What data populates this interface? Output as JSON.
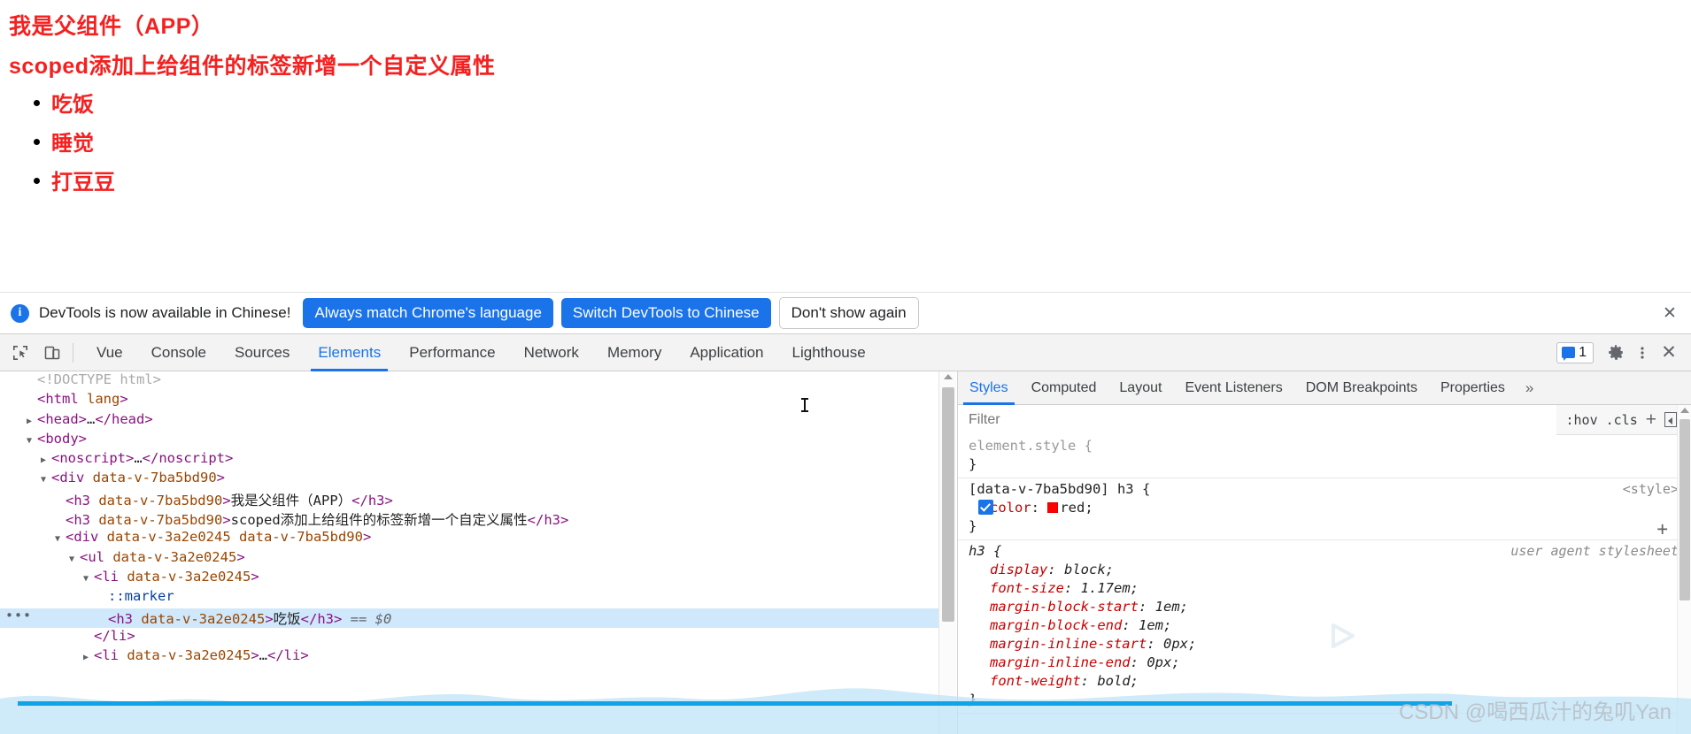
{
  "page": {
    "title1": "我是父组件（APP）",
    "title2": "scoped添加上给组件的标签新增一个自定义属性",
    "list": [
      {
        "text": "吃饭"
      },
      {
        "text": "睡觉"
      },
      {
        "text": "打豆豆"
      }
    ],
    "text_color": "#f52020"
  },
  "notification": {
    "icon": "info-icon",
    "message": "DevTools is now available in Chinese!",
    "primary_button_1": "Always match Chrome's language",
    "primary_button_2": "Switch DevTools to Chinese",
    "secondary_button": "Don't show again",
    "close_icon": "✕",
    "accent": "#1a73e8"
  },
  "devtools": {
    "tools": [
      {
        "name": "inspect-element-icon"
      },
      {
        "name": "device-toolbar-icon"
      }
    ],
    "tabs": [
      {
        "label": "Vue",
        "active": false
      },
      {
        "label": "Console",
        "active": false
      },
      {
        "label": "Sources",
        "active": false
      },
      {
        "label": "Elements",
        "active": true
      },
      {
        "label": "Performance",
        "active": false
      },
      {
        "label": "Network",
        "active": false
      },
      {
        "label": "Memory",
        "active": false
      },
      {
        "label": "Application",
        "active": false
      },
      {
        "label": "Lighthouse",
        "active": false
      }
    ],
    "issues_count": "1",
    "settings_icon": "gear-icon",
    "more_icon": "kebab-menu-icon",
    "close_icon": "✕"
  },
  "dom_tree": [
    {
      "indent": 0,
      "twisty": "",
      "segments": [
        {
          "t": "comment",
          "v": "<!DOCTYPE html>"
        }
      ]
    },
    {
      "indent": 0,
      "twisty": "",
      "segments": [
        {
          "t": "tag",
          "v": "<html "
        },
        {
          "t": "attr",
          "v": "lang"
        },
        {
          "t": "tag",
          "v": ">"
        }
      ]
    },
    {
      "indent": 0,
      "twisty": "▶",
      "segments": [
        {
          "t": "tag",
          "v": "<head>"
        },
        {
          "t": "txt",
          "v": "…"
        },
        {
          "t": "tag",
          "v": "</head>"
        }
      ]
    },
    {
      "indent": 0,
      "twisty": "▼",
      "segments": [
        {
          "t": "tag",
          "v": "<body>"
        }
      ]
    },
    {
      "indent": 1,
      "twisty": "▶",
      "segments": [
        {
          "t": "tag",
          "v": "<noscript>"
        },
        {
          "t": "txt",
          "v": "…"
        },
        {
          "t": "tag",
          "v": "</noscript>"
        }
      ]
    },
    {
      "indent": 1,
      "twisty": "▼",
      "segments": [
        {
          "t": "tag",
          "v": "<div "
        },
        {
          "t": "attr",
          "v": "data-v-7ba5bd90"
        },
        {
          "t": "tag",
          "v": ">"
        }
      ]
    },
    {
      "indent": 2,
      "twisty": "",
      "segments": [
        {
          "t": "tag",
          "v": "<h3 "
        },
        {
          "t": "attr",
          "v": "data-v-7ba5bd90"
        },
        {
          "t": "tag",
          "v": ">"
        },
        {
          "t": "txt",
          "v": "我是父组件（APP）"
        },
        {
          "t": "tag",
          "v": "</h3>"
        }
      ]
    },
    {
      "indent": 2,
      "twisty": "",
      "segments": [
        {
          "t": "tag",
          "v": "<h3 "
        },
        {
          "t": "attr",
          "v": "data-v-7ba5bd90"
        },
        {
          "t": "tag",
          "v": ">"
        },
        {
          "t": "txt",
          "v": "scoped添加上给组件的标签新增一个自定义属性"
        },
        {
          "t": "tag",
          "v": "</h3>"
        }
      ]
    },
    {
      "indent": 2,
      "twisty": "▼",
      "segments": [
        {
          "t": "tag",
          "v": "<div "
        },
        {
          "t": "attr",
          "v": "data-v-3a2e0245 data-v-7ba5bd90"
        },
        {
          "t": "tag",
          "v": ">"
        }
      ]
    },
    {
      "indent": 3,
      "twisty": "▼",
      "segments": [
        {
          "t": "tag",
          "v": "<ul "
        },
        {
          "t": "attr",
          "v": "data-v-3a2e0245"
        },
        {
          "t": "tag",
          "v": ">"
        }
      ]
    },
    {
      "indent": 4,
      "twisty": "▼",
      "segments": [
        {
          "t": "tag",
          "v": "<li "
        },
        {
          "t": "attr",
          "v": "data-v-3a2e0245"
        },
        {
          "t": "tag",
          "v": ">"
        }
      ]
    },
    {
      "indent": 5,
      "twisty": "",
      "segments": [
        {
          "t": "pseudo",
          "v": "::marker"
        }
      ]
    },
    {
      "indent": 5,
      "twisty": "",
      "selected": true,
      "dots": "•••",
      "segments": [
        {
          "t": "tag",
          "v": "<h3 "
        },
        {
          "t": "attr",
          "v": "data-v-3a2e0245"
        },
        {
          "t": "tag",
          "v": ">"
        },
        {
          "t": "txt",
          "v": "吃饭"
        },
        {
          "t": "tag",
          "v": "</h3>"
        },
        {
          "t": "dollar",
          "v": " == $0"
        }
      ]
    },
    {
      "indent": 4,
      "twisty": "",
      "segments": [
        {
          "t": "tag",
          "v": "</li>"
        }
      ]
    },
    {
      "indent": 4,
      "twisty": "▶",
      "segments": [
        {
          "t": "tag",
          "v": "<li "
        },
        {
          "t": "attr",
          "v": "data-v-3a2e0245"
        },
        {
          "t": "tag",
          "v": ">"
        },
        {
          "t": "txt",
          "v": "…"
        },
        {
          "t": "tag",
          "v": "</li>"
        }
      ]
    }
  ],
  "styles_panel": {
    "tabs": [
      {
        "label": "Styles",
        "active": true
      },
      {
        "label": "Computed",
        "active": false
      },
      {
        "label": "Layout",
        "active": false
      },
      {
        "label": "Event Listeners",
        "active": false
      },
      {
        "label": "DOM Breakpoints",
        "active": false
      },
      {
        "label": "Properties",
        "active": false
      }
    ],
    "more_tabs_icon": "»",
    "filter_placeholder": "Filter",
    "filter_value": "",
    "toolbar": {
      "hov": ":hov",
      "cls": ".cls",
      "new_rule_icon": "+",
      "toggle_sidebar_icon": "panel-toggle-icon"
    },
    "rules": [
      {
        "selector": "element.style {",
        "selector_style": "gray",
        "origin": "",
        "declarations": [],
        "close": "}"
      },
      {
        "selector": "[data-v-7ba5bd90] h3 {",
        "selector_style": "plain",
        "origin": "<style>",
        "origin_italic": false,
        "declarations": [
          {
            "checkbox": true,
            "property": "color",
            "value": "red",
            "swatch": "#ff0000",
            "italic": false
          }
        ],
        "close": "}",
        "has_plus": true
      },
      {
        "selector": "h3 {",
        "selector_style": "italic",
        "origin": "user agent stylesheet",
        "origin_italic": true,
        "declarations": [
          {
            "checkbox": false,
            "property": "display",
            "value": "block",
            "italic": true
          },
          {
            "checkbox": false,
            "property": "font-size",
            "value": "1.17em",
            "italic": true
          },
          {
            "checkbox": false,
            "property": "margin-block-start",
            "value": "1em",
            "italic": true
          },
          {
            "checkbox": false,
            "property": "margin-block-end",
            "value": "1em",
            "italic": true
          },
          {
            "checkbox": false,
            "property": "margin-inline-start",
            "value": "0px",
            "italic": true
          },
          {
            "checkbox": false,
            "property": "margin-inline-end",
            "value": "0px",
            "italic": true
          },
          {
            "checkbox": false,
            "property": "font-weight",
            "value": "bold",
            "italic": true
          }
        ],
        "close": "}"
      }
    ]
  },
  "watermark": {
    "text": "CSDN @喝西瓜汁的兔叽Yan",
    "logo": "csdn-play-logo"
  }
}
